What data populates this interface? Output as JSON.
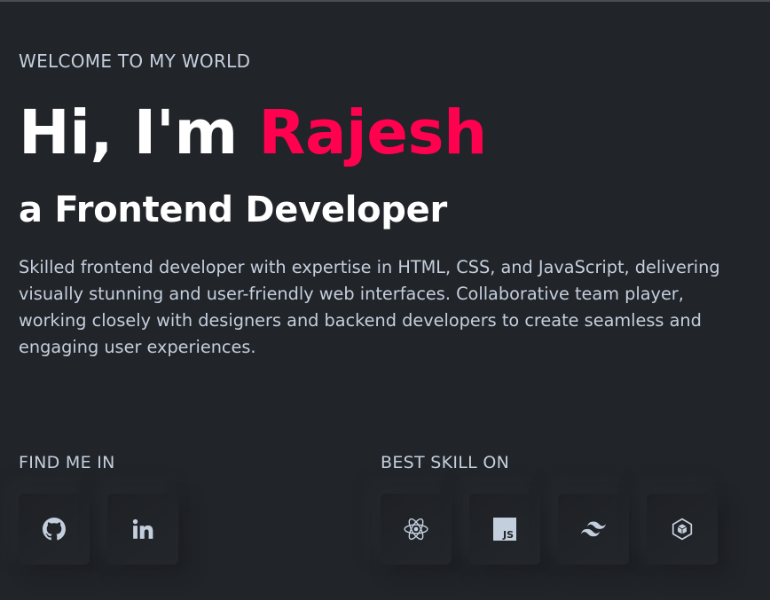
{
  "hero": {
    "eyebrow": "WELCOME TO MY WORLD",
    "greeting": "Hi, I'm ",
    "name": "Rajesh",
    "role": "a Frontend Developer",
    "bio": "Skilled frontend developer with expertise in HTML, CSS, and JavaScript, delivering visually stunning and user-friendly web interfaces. Collaborative team player, working closely with designers and backend developers to create seamless and engaging user experiences."
  },
  "find_me": {
    "label": "FIND ME IN",
    "links": [
      {
        "icon": "github-icon"
      },
      {
        "icon": "linkedin-icon"
      }
    ]
  },
  "skills": {
    "label": "BEST SKILL ON",
    "items": [
      {
        "icon": "react-icon"
      },
      {
        "icon": "javascript-icon",
        "badge_text": "JS"
      },
      {
        "icon": "tailwind-icon"
      },
      {
        "icon": "webpack-icon"
      }
    ]
  },
  "colors": {
    "background": "#212428",
    "accent": "#ff014f",
    "heading": "#ffffff",
    "text": "#c4cfde"
  }
}
